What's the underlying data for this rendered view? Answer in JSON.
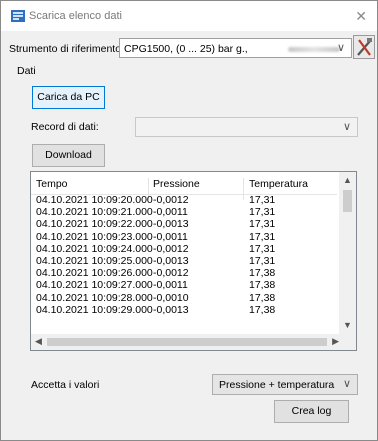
{
  "window": {
    "title": "Scarica elenco dati",
    "close_glyph": "✕"
  },
  "reference": {
    "label": "Strumento di riferimento:",
    "value": "CPG1500, (0 ... 25) bar g.,"
  },
  "section_label": "Dati",
  "buttons": {
    "load_pc": "Carica da PC",
    "download": "Download",
    "create_log": "Crea log"
  },
  "record": {
    "label": "Record di dati:",
    "value": ""
  },
  "table": {
    "columns": [
      "Tempo",
      "Pressione",
      "Temperatura"
    ],
    "rows": [
      [
        "04.10.2021 10:09:20.000",
        "-0,0012",
        "17,31"
      ],
      [
        "04.10.2021 10:09:21.000",
        "-0,0011",
        "17,31"
      ],
      [
        "04.10.2021 10:09:22.000",
        "-0,0013",
        "17,31"
      ],
      [
        "04.10.2021 10:09:23.000",
        "-0,0011",
        "17,31"
      ],
      [
        "04.10.2021 10:09:24.000",
        "-0,0012",
        "17,31"
      ],
      [
        "04.10.2021 10:09:25.000",
        "-0,0013",
        "17,31"
      ],
      [
        "04.10.2021 10:09:26.000",
        "-0,0012",
        "17,38"
      ],
      [
        "04.10.2021 10:09:27.000",
        "-0,0011",
        "17,38"
      ],
      [
        "04.10.2021 10:09:28.000",
        "-0,0010",
        "17,38"
      ],
      [
        "04.10.2021 10:09:29.000",
        "-0,0013",
        "17,38"
      ]
    ]
  },
  "accept": {
    "label": "Accetta i valori",
    "value": "Pressione + temperatura"
  },
  "icons": {
    "app": "download-list-icon",
    "tool": "wrench-screwdriver-icon",
    "dropdown": "chevron-down-icon"
  },
  "colors": {
    "focus_border": "#0078d7",
    "focus_fill": "#e5f1fb",
    "window_bg": "#f0f0f0"
  }
}
